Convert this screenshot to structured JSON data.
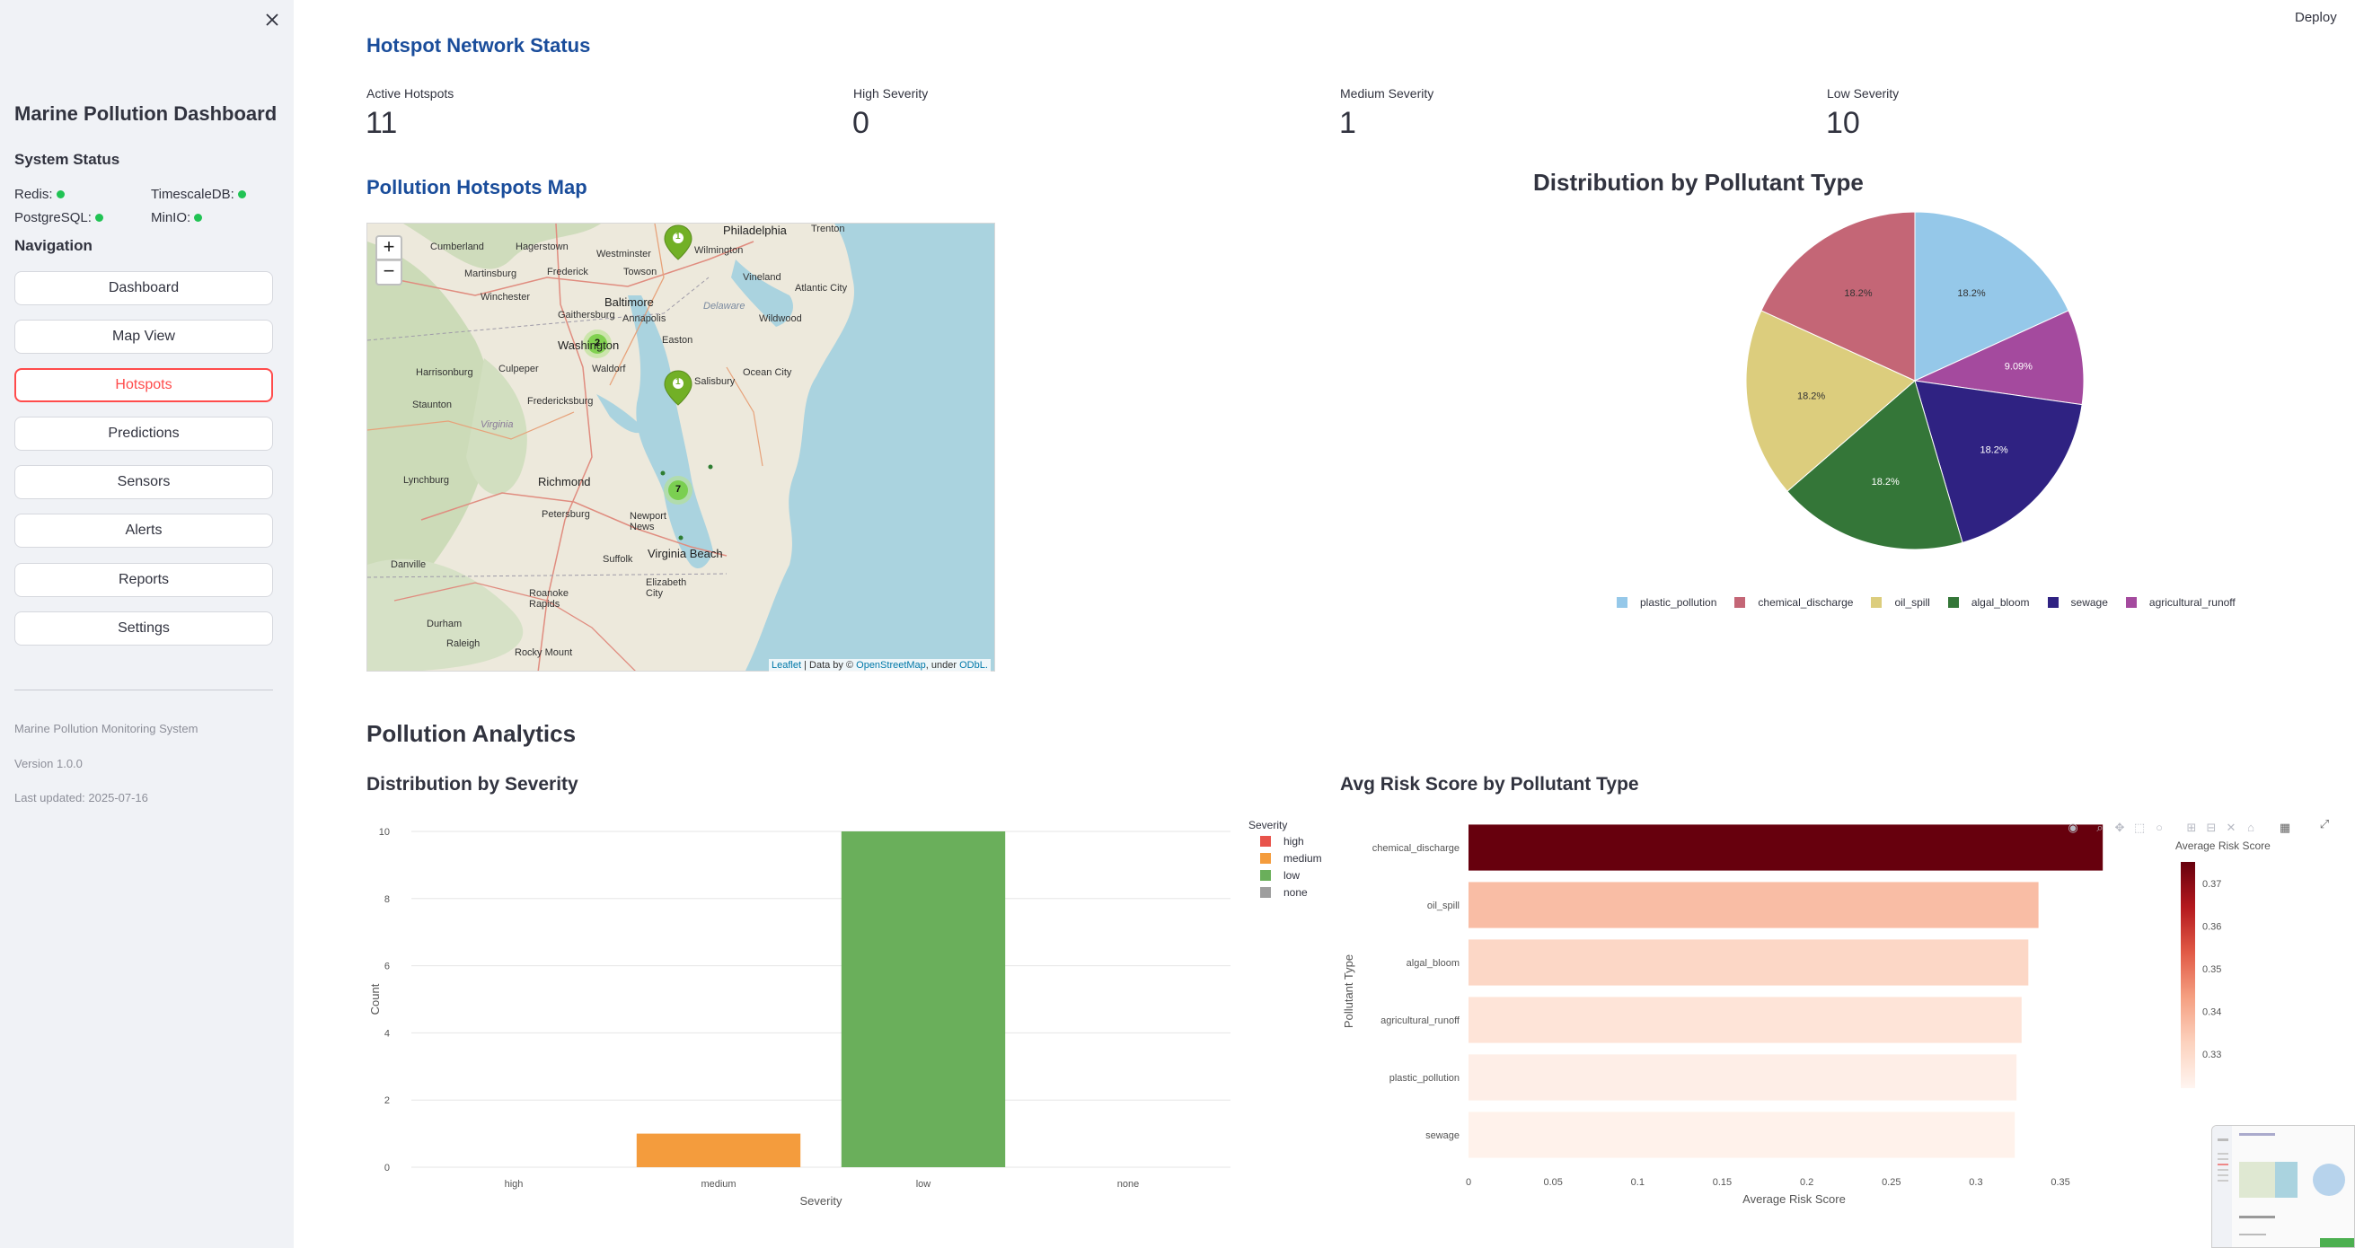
{
  "sidebar": {
    "title": "Marine Pollution Dashboard",
    "system_status_heading": "System Status",
    "services": [
      {
        "label": "Redis:",
        "status_color": "#21c354"
      },
      {
        "label": "TimescaleDB:",
        "status_color": "#21c354"
      },
      {
        "label": "PostgreSQL:",
        "status_color": "#21c354"
      },
      {
        "label": "MinIO:",
        "status_color": "#21c354"
      }
    ],
    "navigation_heading": "Navigation",
    "nav": [
      "Dashboard",
      "Map View",
      "Hotspots",
      "Predictions",
      "Sensors",
      "Alerts",
      "Reports",
      "Settings"
    ],
    "active_nav": "Hotspots",
    "footer": {
      "system": "Marine Pollution Monitoring System",
      "version": "Version 1.0.0",
      "updated": "Last updated: 2025-07-16"
    }
  },
  "header": {
    "deploy_label": "Deploy"
  },
  "network_status": {
    "title": "Hotspot Network Status",
    "metrics": [
      {
        "label": "Active Hotspots",
        "value": "11"
      },
      {
        "label": "High Severity",
        "value": "0"
      },
      {
        "label": "Medium Severity",
        "value": "1"
      },
      {
        "label": "Low Severity",
        "value": "10"
      }
    ]
  },
  "map": {
    "title": "Pollution Hotspots Map",
    "zoom_in": "+",
    "zoom_out": "−",
    "attribution": {
      "leaflet": "Leaflet",
      "sep1": " | Data by © ",
      "osm": "OpenStreetMap",
      "sep2": ", under ",
      "odbl": "ODbL."
    },
    "cluster_counts": [
      "2",
      "7"
    ],
    "marker_counts": [
      "1",
      "1"
    ],
    "place_labels": [
      "Philadelphia",
      "Cumberland",
      "Hagerstown",
      "Westminster",
      "Towson",
      "Wilmington",
      "Trenton",
      "Martinsburg",
      "Frederick",
      "Baltimore",
      "Vineland",
      "Winchester",
      "Gaithersburg",
      "Annapolis",
      "Delaware",
      "Atlantic City",
      "Wildwood",
      "Washington",
      "Easton",
      "Harrisonburg",
      "Culpeper",
      "Waldorf",
      "Ocean City",
      "Salisbury",
      "Staunton",
      "Fredericksburg",
      "Virginia",
      "Lynchburg",
      "Richmond",
      "Petersburg",
      "Newport News",
      "Danville",
      "Suffolk",
      "Virginia Beach",
      "Elizabeth City",
      "Roanoke Rapids",
      "Durham",
      "Raleigh",
      "Rocky Mount"
    ]
  },
  "pie_chart": {
    "chart_data": {
      "type": "pie",
      "title": "Distribution by Pollutant Type",
      "labels": [
        "plastic_pollution",
        "chemical_discharge",
        "oil_spill",
        "algal_bloom",
        "sewage",
        "agricultural_runoff"
      ],
      "slice_order": [
        "plastic_pollution",
        "agricultural_runoff",
        "sewage",
        "algal_bloom",
        "oil_spill",
        "chemical_discharge"
      ],
      "values": {
        "plastic_pollution": 18.2,
        "agricultural_runoff": 9.09,
        "sewage": 18.2,
        "algal_bloom": 18.2,
        "oil_spill": 18.2,
        "chemical_discharge": 18.2
      },
      "value_labels": {
        "plastic_pollution": "18.2%",
        "agricultural_runoff": "9.09%",
        "sewage": "18.2%",
        "algal_bloom": "18.2%",
        "oil_spill": "18.2%",
        "chemical_discharge": "18.2%"
      },
      "colors": {
        "plastic_pollution": "#95c8e9",
        "chemical_discharge": "#c46676",
        "oil_spill": "#dccd7d",
        "algal_bloom": "#347638",
        "sewage": "#2f2282",
        "agricultural_runoff": "#a44a9e"
      },
      "label_colors": {
        "plastic_pollution": "#333333",
        "agricultural_runoff": "#ffffff",
        "sewage": "#ffffff",
        "algal_bloom": "#ffffff",
        "oil_spill": "#333333",
        "chemical_discharge": "#333333"
      },
      "legend_position": "bottom"
    }
  },
  "analytics": {
    "title": "Pollution Analytics"
  },
  "severity_chart": {
    "chart_data": {
      "type": "bar",
      "title": "Distribution by Severity",
      "categories": [
        "high",
        "medium",
        "low",
        "none"
      ],
      "values": [
        0,
        1,
        10,
        0
      ],
      "colors": [
        "#e8534b",
        "#f49c3d",
        "#6aaf5b",
        "#9e9e9e"
      ],
      "xlabel": "Severity",
      "ylabel": "Count",
      "ylim": [
        0,
        10
      ],
      "yticks": [
        "0",
        "2",
        "4",
        "6",
        "8",
        "10"
      ],
      "legend_title": "Severity",
      "legend_position": "top-right",
      "grid": true
    }
  },
  "risk_chart": {
    "chart_data": {
      "type": "bar",
      "orientation": "horizontal",
      "title": "Avg Risk Score by Pollutant Type",
      "categories": [
        "chemical_discharge",
        "oil_spill",
        "algal_bloom",
        "agricultural_runoff",
        "plastic_pollution",
        "sewage"
      ],
      "values": [
        0.375,
        0.337,
        0.331,
        0.327,
        0.324,
        0.323
      ],
      "xlabel": "Average Risk Score",
      "ylabel": "Pollutant Type",
      "xlim": [
        0,
        0.385
      ],
      "xticks": [
        "0",
        "0.05",
        "0.1",
        "0.15",
        "0.2",
        "0.25",
        "0.3",
        "0.35"
      ],
      "colorbar_title": "Average Risk Score",
      "colorbar_ticks": [
        "0.37",
        "0.36",
        "0.35",
        "0.34",
        "0.33"
      ],
      "colorscale": "Reds"
    }
  }
}
